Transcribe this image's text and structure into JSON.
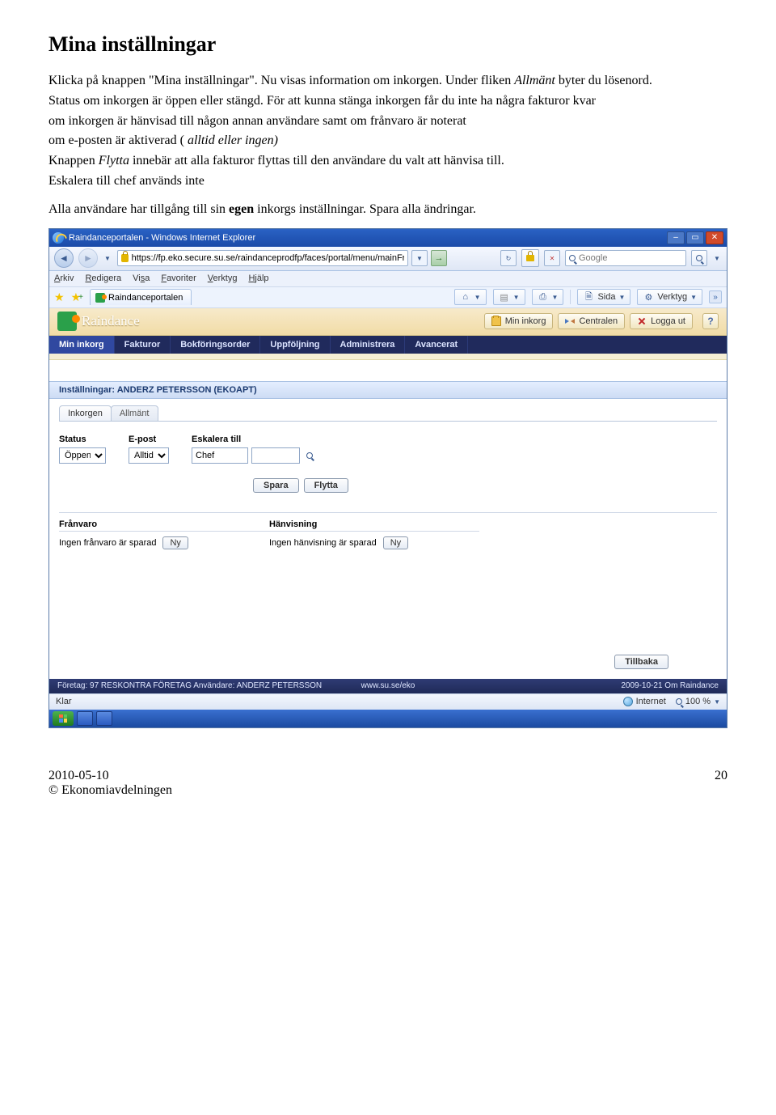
{
  "doc": {
    "heading": "Mina inställningar",
    "para1": "Klicka på knappen \"Mina inställningar\". Nu visas information om inkorgen. Under fliken ",
    "para1_italic": "Allmänt",
    "para1_end": " byter du lösenord.",
    "para2": "Status om inkorgen är öppen eller stängd. För att kunna stänga inkorgen får du inte ha några fakturor kvar",
    "para3": "om inkorgen är hänvisad till någon annan användare samt om frånvaro är noterat",
    "para4_a": "om e-posten är aktiverad ( ",
    "para4_italic": "alltid eller ingen)",
    "para5_a": "Knappen ",
    "para5_italic": "Flytta",
    "para5_b": " innebär att alla fakturor flyttas till den användare du valt att hänvisa till.",
    "para6": "Eskalera till chef används inte",
    "para7_a": "Alla användare har tillgång till sin ",
    "para7_bold": "egen",
    "para7_b": " inkorgs inställningar. Spara alla ändringar."
  },
  "ie": {
    "title": "Raindanceportalen - Windows Internet Explorer",
    "url": "https://fp.eko.secure.su.se/raindanceprodfp/faces/portal/menu/mainFrameset.jsp",
    "search_placeholder": "Google",
    "menu": {
      "arkiv": "Arkiv",
      "redigera": "Redigera",
      "visa": "Visa",
      "favoriter": "Favoriter",
      "verktyg": "Verktyg",
      "hjalp": "Hjälp"
    },
    "tab_label": "Raindanceportalen",
    "sida": "Sida",
    "verktyg": "Verktyg",
    "status_left": "Klar",
    "status_internet": "Internet",
    "status_zoom": "100 %"
  },
  "rd": {
    "brand": "Raindance",
    "btn_inkorg": "Min inkorg",
    "btn_centralen": "Centralen",
    "btn_logout": "Logga ut",
    "help": "?",
    "menu": [
      "Min inkorg",
      "Fakturor",
      "Bokföringsorder",
      "Uppföljning",
      "Administrera",
      "Avancerat"
    ],
    "panel_title": "Inställningar: ANDERZ PETERSSON (EKOAPT)",
    "tabs": {
      "inkorgen": "Inkorgen",
      "allmant": "Allmänt"
    },
    "labels": {
      "status": "Status",
      "epost": "E-post",
      "eskalera": "Eskalera till"
    },
    "status_value": "Öppen",
    "epost_value": "Alltid",
    "eskalera_value": "Chef",
    "btn_spara": "Spara",
    "btn_flytta": "Flytta",
    "franvaro_h": "Frånvaro",
    "franvaro_txt": "Ingen frånvaro är sparad",
    "hanvisning_h": "Hänvisning",
    "hanvisning_txt": "Ingen hänvisning är sparad",
    "btn_ny": "Ny",
    "btn_tillbaka": "Tillbaka",
    "footer_left": "Företag: 97 RESKONTRA FÖRETAG   Användare: ANDERZ PETERSSON",
    "footer_mid": "www.su.se/eko",
    "footer_right": "2009-10-21   Om Raindance"
  },
  "footer": {
    "date": "2010-05-10",
    "org": "© Ekonomiavdelningen",
    "page": "20"
  }
}
